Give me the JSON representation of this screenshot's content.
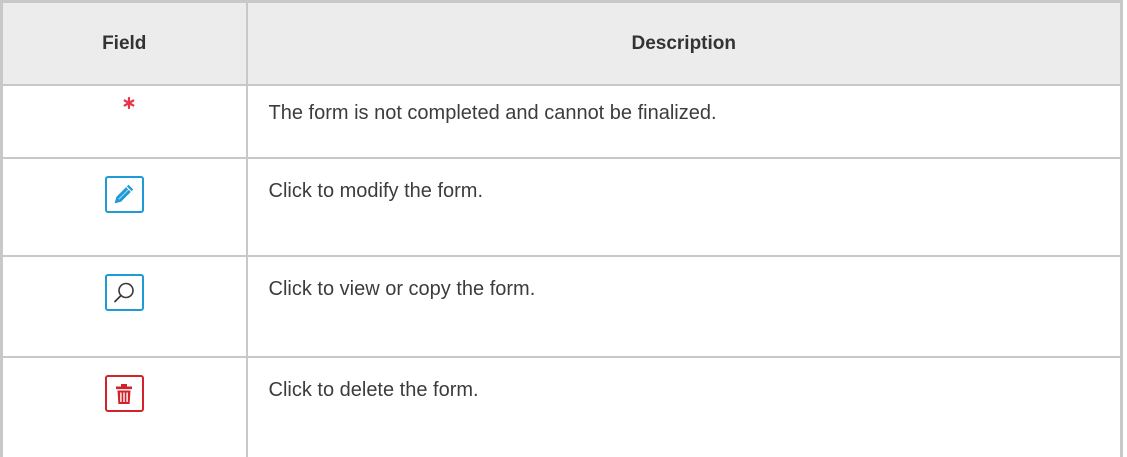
{
  "table": {
    "header": {
      "field": "Field",
      "description": "Description"
    },
    "rows": [
      {
        "icon": "asterisk-icon",
        "description": "The form is not completed and cannot be finalized."
      },
      {
        "icon": "pencil-icon",
        "description": "Click to modify the form."
      },
      {
        "icon": "magnifier-icon",
        "description": "Click to view or copy the form."
      },
      {
        "icon": "trash-icon",
        "description": "Click to delete the form."
      }
    ]
  },
  "colors": {
    "header_bg": "#ececec",
    "border": "#c8c8c8",
    "edit_blue": "#1e9ad6",
    "delete_red": "#d2232a",
    "asterisk_red": "#e8334a"
  }
}
